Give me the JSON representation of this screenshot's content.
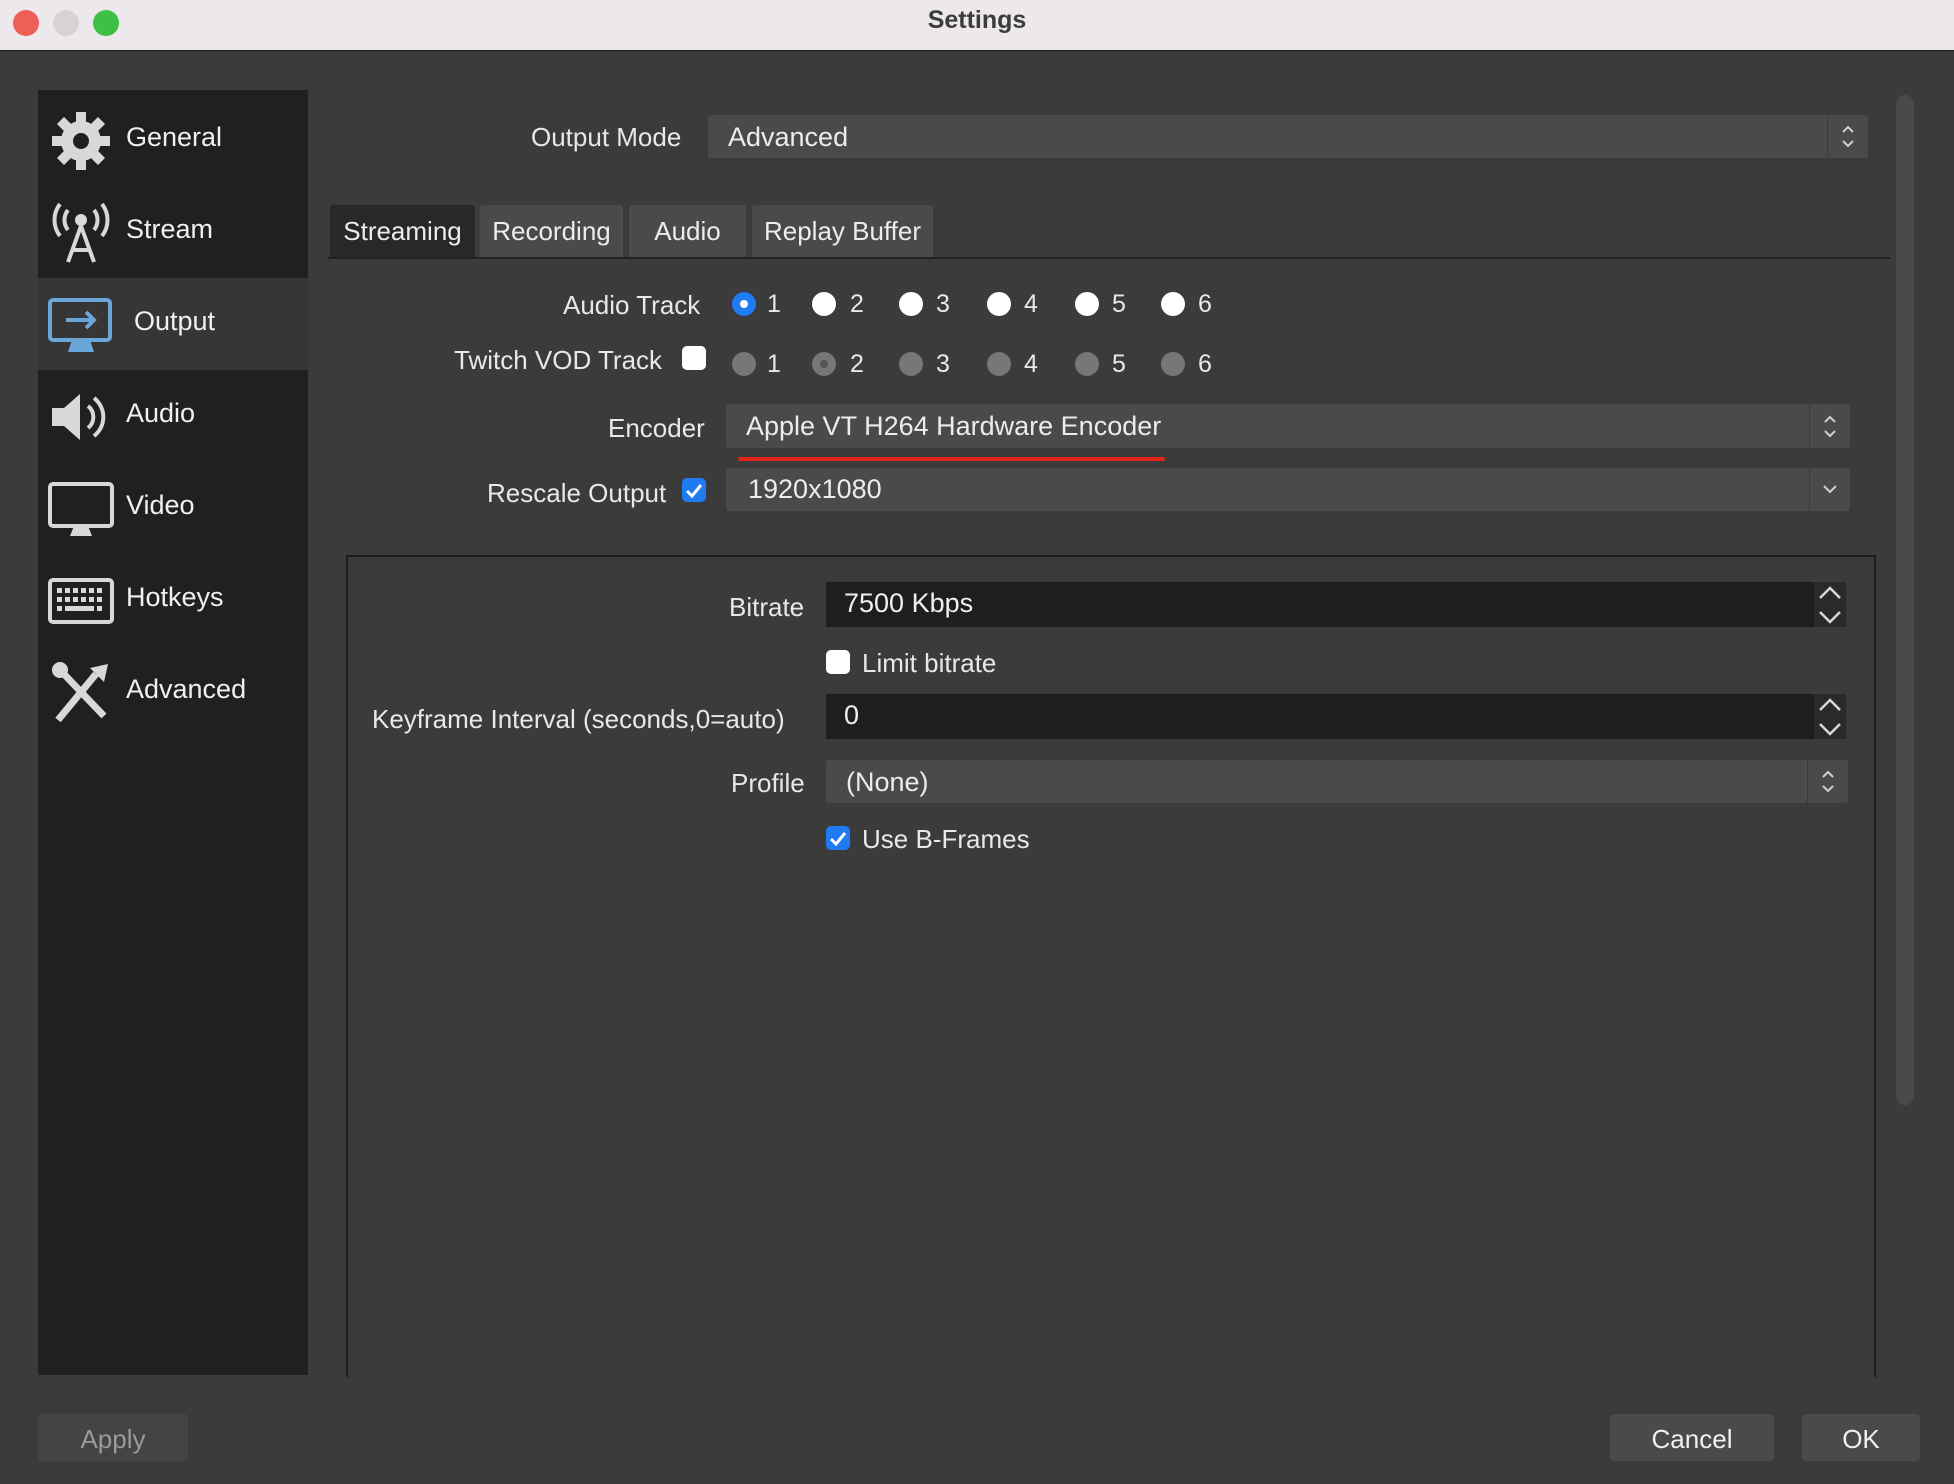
{
  "window": {
    "title": "Settings"
  },
  "sidebar": {
    "items": [
      {
        "label": "General",
        "icon": "gear-icon"
      },
      {
        "label": "Stream",
        "icon": "antenna-icon"
      },
      {
        "label": "Output",
        "icon": "output-monitor-icon",
        "selected": true
      },
      {
        "label": "Audio",
        "icon": "speaker-icon"
      },
      {
        "label": "Video",
        "icon": "monitor-icon"
      },
      {
        "label": "Hotkeys",
        "icon": "keyboard-icon"
      },
      {
        "label": "Advanced",
        "icon": "tools-icon"
      }
    ]
  },
  "output_mode": {
    "label": "Output Mode",
    "value": "Advanced"
  },
  "tabs": [
    {
      "label": "Streaming",
      "selected": true
    },
    {
      "label": "Recording"
    },
    {
      "label": "Audio"
    },
    {
      "label": "Replay Buffer"
    }
  ],
  "audio_track": {
    "label": "Audio Track",
    "options": [
      "1",
      "2",
      "3",
      "4",
      "5",
      "6"
    ],
    "selected": "1"
  },
  "twitch_vod": {
    "label": "Twitch VOD Track",
    "checked": false,
    "options": [
      "1",
      "2",
      "3",
      "4",
      "5",
      "6"
    ],
    "selected": "2",
    "disabled": true
  },
  "encoder": {
    "label": "Encoder",
    "value": "Apple VT H264 Hardware Encoder",
    "highlight_color": "#e0261b"
  },
  "rescale": {
    "label": "Rescale Output",
    "checked": true,
    "value": "1920x1080"
  },
  "settings": {
    "bitrate": {
      "label": "Bitrate",
      "value": "7500 Kbps"
    },
    "limit_bitrate": {
      "label": "Limit bitrate",
      "checked": false
    },
    "keyframe": {
      "label": "Keyframe Interval (seconds,0=auto)",
      "value": "0"
    },
    "profile": {
      "label": "Profile",
      "value": "(None)"
    },
    "bframes": {
      "label": "Use B-Frames",
      "checked": true
    }
  },
  "buttons": {
    "apply": "Apply",
    "cancel": "Cancel",
    "ok": "OK"
  },
  "colors": {
    "accent": "#1f7bf2",
    "sidebar_bg": "#202020",
    "window_bg": "#3b3b3b"
  }
}
